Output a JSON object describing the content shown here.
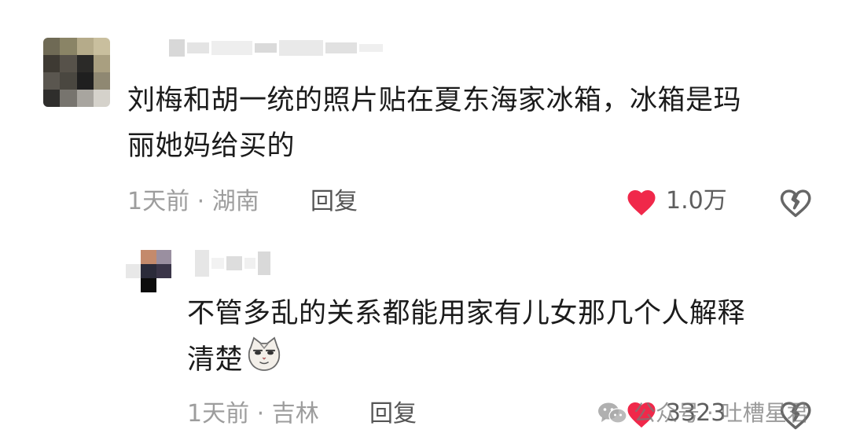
{
  "comment": {
    "text_line1": "刘梅和胡一统的照片贴在夏东海家冰箱，冰箱是玛",
    "text_line2": "丽她妈给买的",
    "time_location": "1天前 · 湖南",
    "reply_label": "回复",
    "like_count": "1.0万",
    "liked": true
  },
  "reply": {
    "text_line1": "不管多乱的关系都能用家有儿女那几个人解释",
    "text_line2": "清楚",
    "emoji": "cat-face-emoji",
    "time_location": "1天前 · 吉林",
    "reply_label": "回复",
    "like_count": "3323",
    "liked": true
  },
  "watermark": {
    "text": "公众号 · 吐槽星君",
    "icon": "wechat-icon"
  },
  "colors": {
    "like_red": "#f0284a",
    "text": "#1b1b1b",
    "meta_gray": "#9d9d9d"
  }
}
